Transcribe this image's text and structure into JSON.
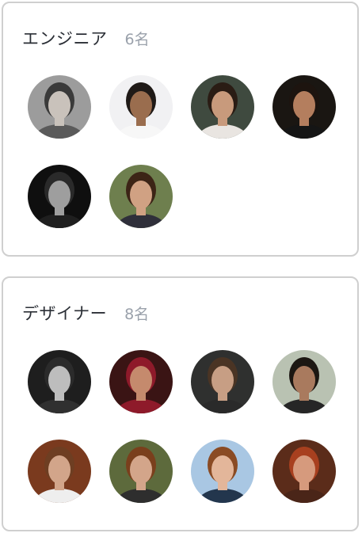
{
  "groups": [
    {
      "title": "エンジニア",
      "count": "6名",
      "members": [
        {
          "icon": "person-avatar",
          "bg": "#9c9c9c",
          "skin": "#c9c2bb",
          "hair": "#3a3a3a",
          "shirt": "#5a5a5a"
        },
        {
          "icon": "person-avatar",
          "bg": "#f1f1f3",
          "skin": "#9a6d4e",
          "hair": "#1f1a17",
          "shirt": "#f7f7f7"
        },
        {
          "icon": "person-avatar",
          "bg": "#3f4a3f",
          "skin": "#c89a7c",
          "hair": "#2a1c14",
          "shirt": "#e9e5e1"
        },
        {
          "icon": "person-avatar",
          "bg": "#1a1612",
          "skin": "#b47e5e",
          "hair": "#1d140f",
          "shirt": "#151515"
        },
        {
          "icon": "person-avatar",
          "bg": "#0f0f0f",
          "skin": "#9e9e9e",
          "hair": "#2a2a2a",
          "shirt": "#1f1f1f"
        },
        {
          "icon": "person-avatar",
          "bg": "#6e7f4e",
          "skin": "#d0a183",
          "hair": "#3c2416",
          "shirt": "#2f2f3a"
        }
      ]
    },
    {
      "title": "デザイナー",
      "count": "8名",
      "members": [
        {
          "icon": "person-avatar",
          "bg": "#1e1e1e",
          "skin": "#bdbdbd",
          "hair": "#2b2b2b",
          "shirt": "#303030"
        },
        {
          "icon": "person-avatar",
          "bg": "#3a1414",
          "skin": "#c58a6d",
          "hair": "#8e1a2a",
          "shirt": "#8e1a2a"
        },
        {
          "icon": "person-avatar",
          "bg": "#2f302f",
          "skin": "#c79e84",
          "hair": "#4a3424",
          "shirt": "#2a2a2a"
        },
        {
          "icon": "person-avatar",
          "bg": "#b9c2b2",
          "skin": "#a97a5e",
          "hair": "#1c1712",
          "shirt": "#262626"
        },
        {
          "icon": "person-avatar",
          "bg": "#7a3a1e",
          "skin": "#d2a58a",
          "hair": "#6e3e22",
          "shirt": "#eeeeee"
        },
        {
          "icon": "person-avatar",
          "bg": "#5d6a3c",
          "skin": "#d3a58a",
          "hair": "#7a3f1c",
          "shirt": "#2e2e2e"
        },
        {
          "icon": "person-avatar",
          "bg": "#a9c7e3",
          "skin": "#e3b69a",
          "hair": "#8a4b24",
          "shirt": "#23364d"
        },
        {
          "icon": "person-avatar",
          "bg": "#5b2c1a",
          "skin": "#d69a7d",
          "hair": "#a8401f",
          "shirt": "#4a2518"
        }
      ]
    }
  ]
}
